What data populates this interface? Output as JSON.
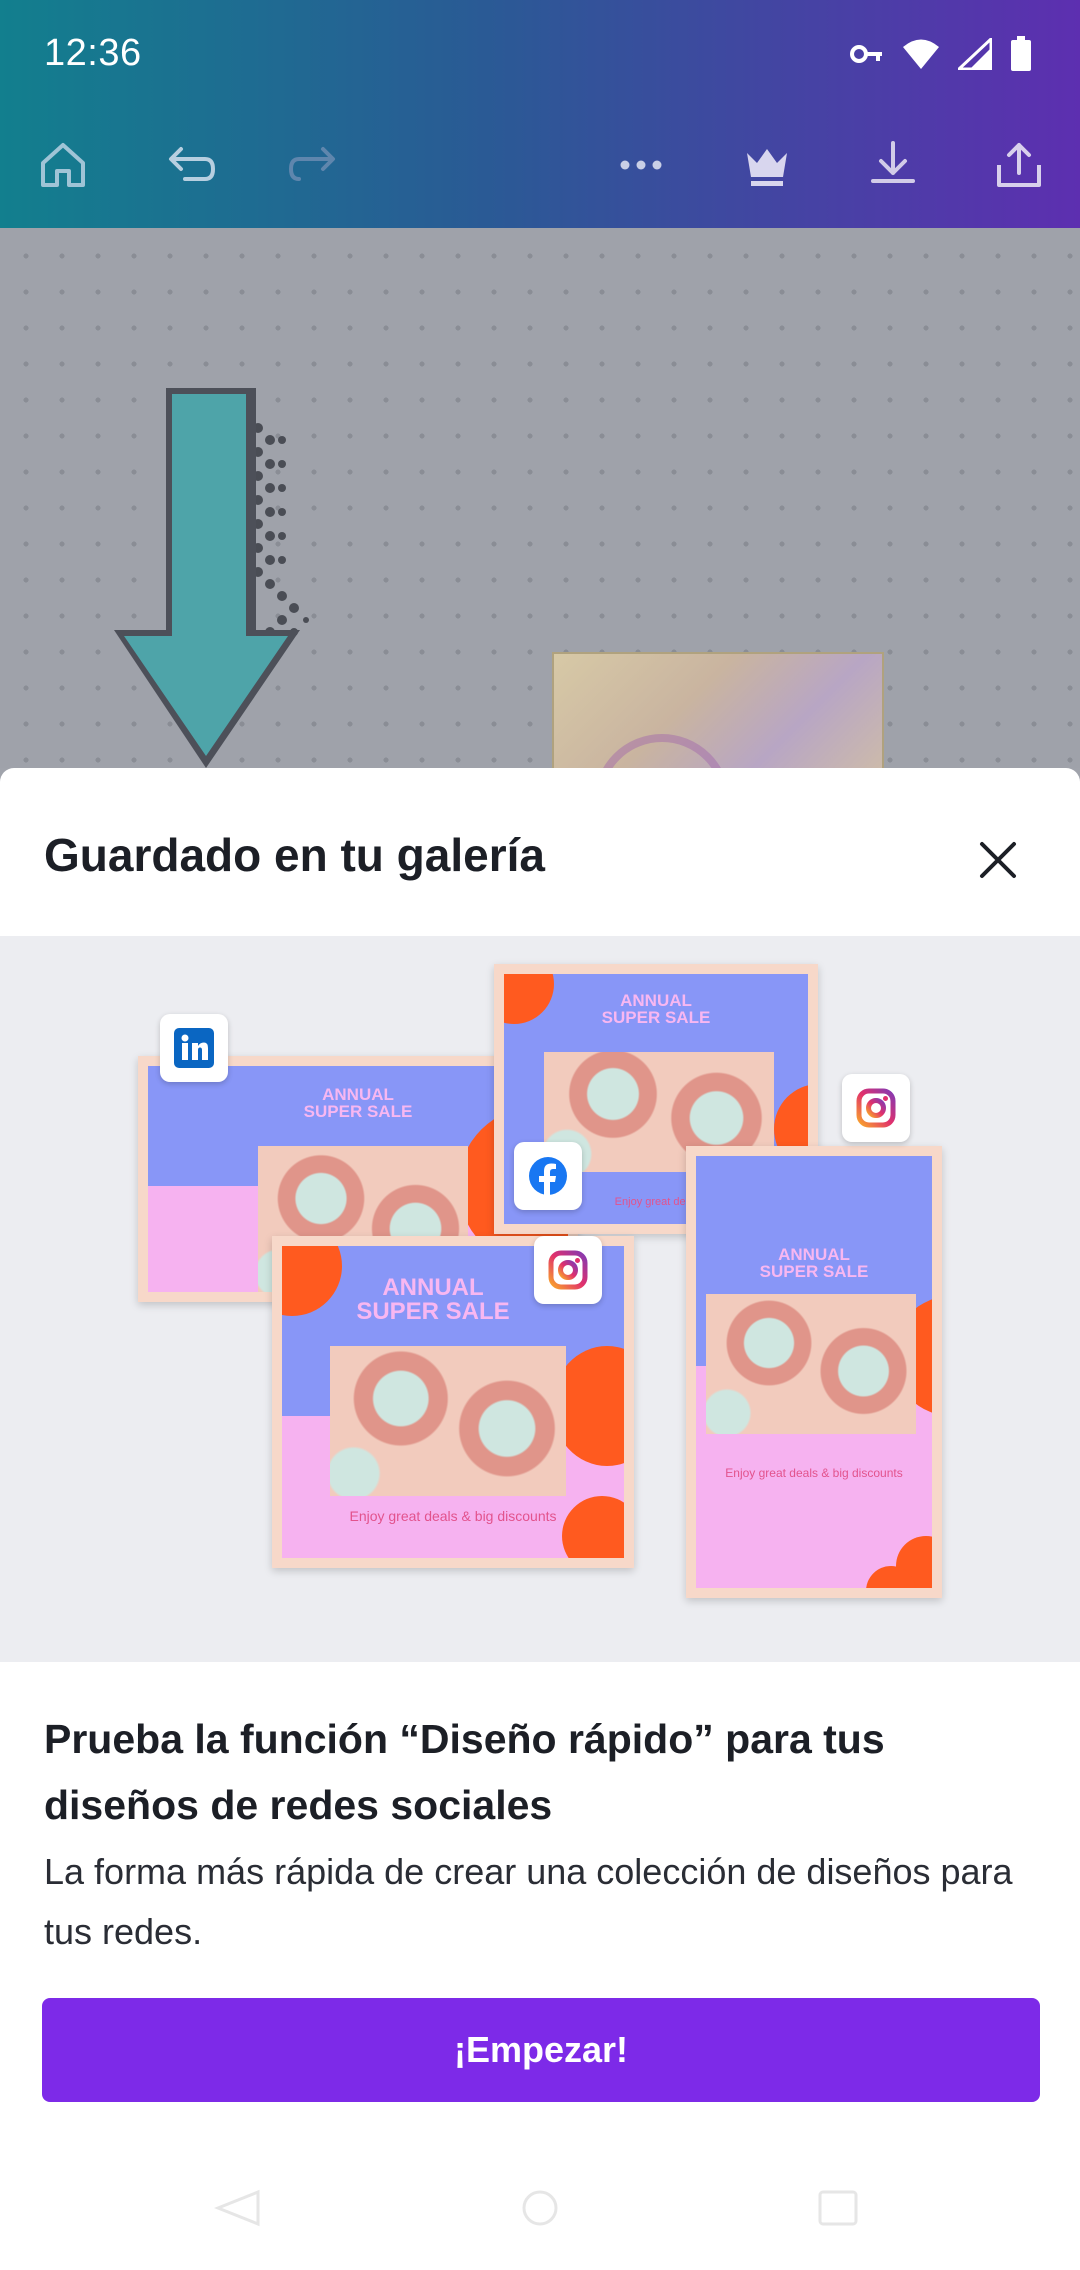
{
  "status_bar": {
    "time": "12:36",
    "icons": [
      "vpn-key-icon",
      "wifi-icon",
      "signal-icon",
      "battery-icon"
    ]
  },
  "toolbar": {
    "buttons": [
      "home-icon",
      "undo-icon",
      "redo-icon",
      "more-icon",
      "crown-icon",
      "download-icon",
      "share-icon"
    ]
  },
  "sheet": {
    "title": "Guardado en tu galería",
    "promo": {
      "cards": [
        {
          "headline_1": "ANNUAL",
          "headline_2": "SUPER SALE",
          "badge": "linkedin-icon"
        },
        {
          "headline_1": "ANNUAL",
          "headline_2": "SUPER SALE",
          "tagline": "Enjoy great deals & big discounts",
          "badge": "facebook-icon"
        },
        {
          "headline_1": "ANNUAL",
          "headline_2": "SUPER SALE",
          "tagline": "Enjoy great deals & big discounts",
          "badge": "instagram-icon"
        },
        {
          "headline_1": "ANNUAL",
          "headline_2": "SUPER SALE",
          "tagline": "Enjoy great deals & big discounts",
          "badge": "instagram-icon"
        }
      ]
    },
    "heading": "Prueba la función “Diseño rápido” para tus diseños de redes sociales",
    "body": "La forma más rápida de crear una colección de diseños para tus redes.",
    "cta_label": "¡Empezar!"
  },
  "colors": {
    "accent": "#7d2ae8",
    "header_gradient_start": "#127f8e",
    "header_gradient_end": "#5d2fb0"
  }
}
